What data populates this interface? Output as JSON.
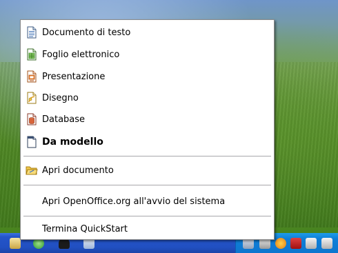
{
  "menu": {
    "items": [
      {
        "label": "Documento di testo",
        "icon": "writer-document-icon"
      },
      {
        "label": "Foglio elettronico",
        "icon": "calc-spreadsheet-icon"
      },
      {
        "label": "Presentazione",
        "icon": "impress-presentation-icon"
      },
      {
        "label": "Disegno",
        "icon": "draw-drawing-icon"
      },
      {
        "label": "Database",
        "icon": "base-database-icon"
      },
      {
        "label": "Da modello",
        "icon": "template-icon"
      },
      {
        "label": "Apri documento",
        "icon": "open-folder-icon"
      },
      {
        "label": "Apri OpenOffice.org all'avvio del sistema"
      },
      {
        "label": "Termina QuickStart"
      }
    ]
  },
  "colors": {
    "menu_bg": "#ffffff",
    "separator": "#a7a6aa",
    "taskbar": "#2454c8",
    "tray": "#0f7fd8"
  }
}
